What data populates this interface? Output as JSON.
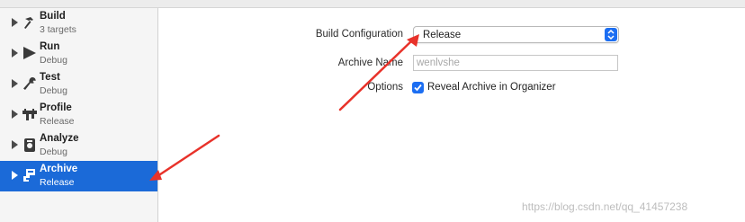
{
  "sidebar": {
    "items": [
      {
        "title": "Build",
        "subtitle": "3 targets",
        "icon": "hammer-icon",
        "selected": false
      },
      {
        "title": "Run",
        "subtitle": "Debug",
        "icon": "play-icon",
        "selected": false
      },
      {
        "title": "Test",
        "subtitle": "Debug",
        "icon": "wrench-icon",
        "selected": false
      },
      {
        "title": "Profile",
        "subtitle": "Release",
        "icon": "profile-icon",
        "selected": false
      },
      {
        "title": "Analyze",
        "subtitle": "Debug",
        "icon": "analyze-icon",
        "selected": false
      },
      {
        "title": "Archive",
        "subtitle": "Release",
        "icon": "archive-icon",
        "selected": true
      }
    ]
  },
  "form": {
    "build_configuration_label": "Build Configuration",
    "build_configuration_value": "Release",
    "archive_name_label": "Archive Name",
    "archive_name_placeholder": "wenlvshe",
    "options_label": "Options",
    "reveal_archive_label": "Reveal Archive in Organizer",
    "reveal_archive_checked": true
  },
  "colors": {
    "selection": "#1b6ad8",
    "accent": "#1c6ef2",
    "annotation_arrow": "#e8322a"
  },
  "watermark": "https://blog.csdn.net/qq_41457238"
}
